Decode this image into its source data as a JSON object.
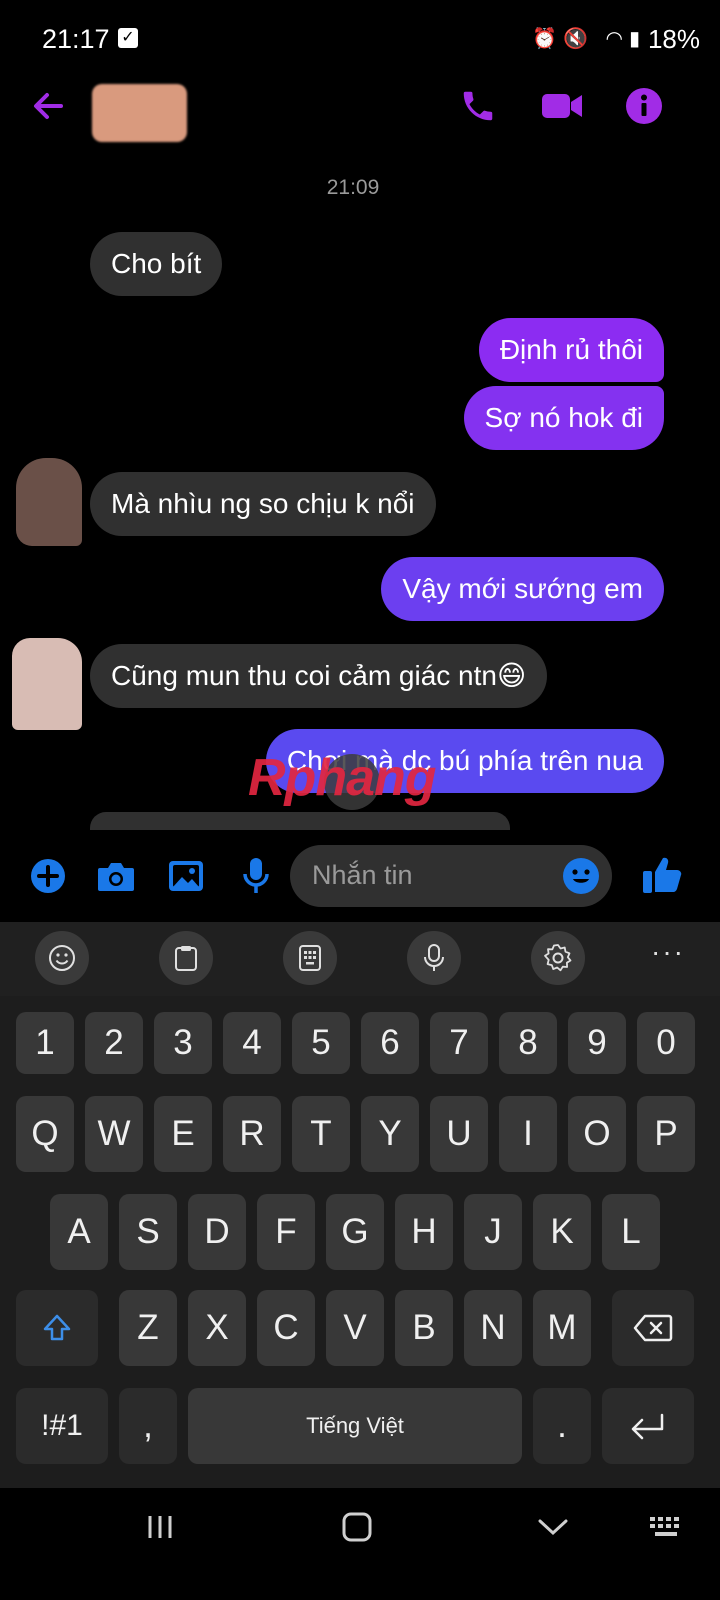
{
  "status": {
    "time": "21:17",
    "battery": "18%",
    "check_icon": "check-square-icon"
  },
  "header": {
    "accent": "#a12ce6"
  },
  "chat": {
    "timestamp": "21:09",
    "messages": [
      {
        "side": "in",
        "text": "Cho bít"
      },
      {
        "side": "out",
        "text": "Định rủ thôi"
      },
      {
        "side": "out",
        "text": "Sợ nó hok đi"
      },
      {
        "side": "in",
        "text": "Mà nhìu ng so chịu k nổi"
      },
      {
        "side": "out",
        "text": "Vậy mới sướng em"
      },
      {
        "side": "in",
        "text": "Cũng mun thu coi cảm giác ntn😄"
      },
      {
        "side": "out",
        "text": "Chơi mà dc bú phía trên nua"
      }
    ],
    "watermark": "Rphang"
  },
  "composer": {
    "placeholder": "Nhắn tin",
    "accent": "#1a78e8"
  },
  "keyboard": {
    "row_numbers": [
      "1",
      "2",
      "3",
      "4",
      "5",
      "6",
      "7",
      "8",
      "9",
      "0"
    ],
    "row_q": [
      "Q",
      "W",
      "E",
      "R",
      "T",
      "Y",
      "U",
      "I",
      "O",
      "P"
    ],
    "row_a": [
      "A",
      "S",
      "D",
      "F",
      "G",
      "H",
      "J",
      "K",
      "L"
    ],
    "row_z": [
      "Z",
      "X",
      "C",
      "V",
      "B",
      "N",
      "M"
    ],
    "symbols_label": "!#1",
    "comma_label": ",",
    "space_label": "Tiếng Việt",
    "period_label": "."
  }
}
